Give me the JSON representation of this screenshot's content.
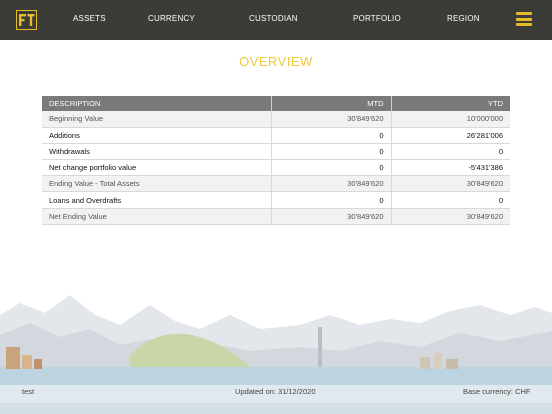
{
  "nav": {
    "items": [
      "ASSETS",
      "CURRENCY",
      "CUSTODIAN",
      "PORTFOLIO",
      "REGION"
    ]
  },
  "brand": {
    "logo_icon": "ft-logo-icon",
    "accent": "#e7bc2a",
    "bar": "#3b3b38"
  },
  "page": {
    "title": "OVERVIEW"
  },
  "table": {
    "headers": [
      "DESCRIPTION",
      "MTD",
      "YTD"
    ],
    "rows": [
      {
        "label": "Beginning Value",
        "mtd": "30'849'620",
        "ytd": "10'000'000"
      },
      {
        "label": "Additions",
        "mtd": "0",
        "ytd": "26'281'006"
      },
      {
        "label": "Withdrawals",
        "mtd": "0",
        "ytd": "0"
      },
      {
        "label": "Net change portfolio value",
        "mtd": "0",
        "ytd": "-5'431'386"
      },
      {
        "label": "Ending Value - Total Assets",
        "mtd": "30'849'620",
        "ytd": "30'849'620"
      },
      {
        "label": "Loans and Overdrafts",
        "mtd": "0",
        "ytd": "0"
      },
      {
        "label": "Net Ending Value",
        "mtd": "30'849'620",
        "ytd": "30'849'620"
      }
    ]
  },
  "footer": {
    "left": "test",
    "center": "Updated on: 31/12/2020",
    "right": "Base currency: CHF"
  }
}
